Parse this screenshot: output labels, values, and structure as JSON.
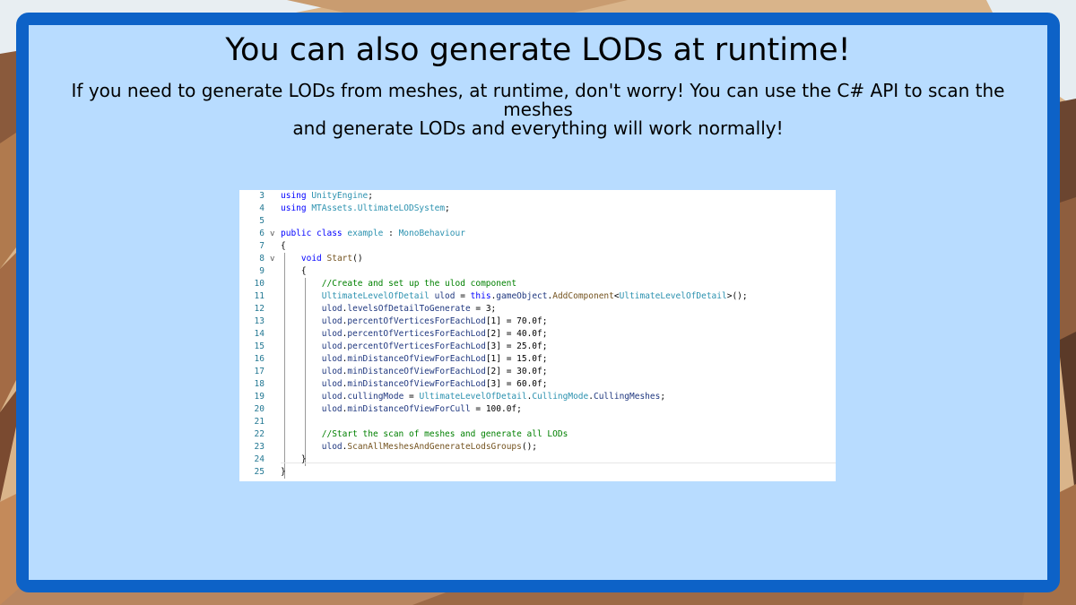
{
  "slide": {
    "title": "You can also generate LODs at runtime!",
    "subtitle_line1": "If you need to generate LODs from meshes, at runtime, don't worry! You can use the C# API to scan the meshes",
    "subtitle_line2": "and generate LODs and everything will work normally!"
  },
  "colors": {
    "frame_border": "#0d62c7",
    "panel_background": "#b8dcff",
    "code_background": "#ffffff"
  },
  "code_lines": [
    {
      "n": "3",
      "fold": "",
      "t": [
        [
          "kw",
          "using "
        ],
        [
          "ty",
          "UnityEngine"
        ],
        [
          "pl",
          ";"
        ]
      ]
    },
    {
      "n": "4",
      "fold": "",
      "t": [
        [
          "kw",
          "using "
        ],
        [
          "ty",
          "MTAssets.UltimateLODSystem"
        ],
        [
          "pl",
          ";"
        ]
      ]
    },
    {
      "n": "5",
      "fold": "",
      "t": []
    },
    {
      "n": "6",
      "fold": "v",
      "t": [
        [
          "kw",
          "public class "
        ],
        [
          "ty",
          "example"
        ],
        [
          "pl",
          " : "
        ],
        [
          "ty",
          "MonoBehaviour"
        ]
      ]
    },
    {
      "n": "7",
      "fold": "",
      "t": [
        [
          "pl",
          "{"
        ]
      ]
    },
    {
      "n": "8",
      "fold": "v",
      "t": [
        [
          "pl",
          "    "
        ],
        [
          "kw",
          "void "
        ],
        [
          "mt",
          "Start"
        ],
        [
          "pl",
          "()"
        ]
      ]
    },
    {
      "n": "9",
      "fold": "",
      "t": [
        [
          "pl",
          "    {"
        ]
      ]
    },
    {
      "n": "10",
      "fold": "",
      "t": [
        [
          "pl",
          "        "
        ],
        [
          "cm",
          "//Create and set up the ulod component"
        ]
      ]
    },
    {
      "n": "11",
      "fold": "",
      "t": [
        [
          "pl",
          "        "
        ],
        [
          "ty",
          "UltimateLevelOfDetail"
        ],
        [
          "pl",
          " "
        ],
        [
          "id",
          "ulod"
        ],
        [
          "pl",
          " = "
        ],
        [
          "kw",
          "this"
        ],
        [
          "pl",
          "."
        ],
        [
          "id",
          "gameObject"
        ],
        [
          "pl",
          "."
        ],
        [
          "mt",
          "AddComponent"
        ],
        [
          "pl",
          "<"
        ],
        [
          "ty",
          "UltimateLevelOfDetail"
        ],
        [
          "pl",
          ">();"
        ]
      ]
    },
    {
      "n": "12",
      "fold": "",
      "t": [
        [
          "pl",
          "        "
        ],
        [
          "id",
          "ulod"
        ],
        [
          "pl",
          "."
        ],
        [
          "id",
          "levelsOfDetailToGenerate"
        ],
        [
          "pl",
          " = 3;"
        ]
      ]
    },
    {
      "n": "13",
      "fold": "",
      "t": [
        [
          "pl",
          "        "
        ],
        [
          "id",
          "ulod"
        ],
        [
          "pl",
          "."
        ],
        [
          "id",
          "percentOfVerticesForEachLod"
        ],
        [
          "pl",
          "[1] = 70.0f;"
        ]
      ]
    },
    {
      "n": "14",
      "fold": "",
      "t": [
        [
          "pl",
          "        "
        ],
        [
          "id",
          "ulod"
        ],
        [
          "pl",
          "."
        ],
        [
          "id",
          "percentOfVerticesForEachLod"
        ],
        [
          "pl",
          "[2] = 40.0f;"
        ]
      ]
    },
    {
      "n": "15",
      "fold": "",
      "t": [
        [
          "pl",
          "        "
        ],
        [
          "id",
          "ulod"
        ],
        [
          "pl",
          "."
        ],
        [
          "id",
          "percentOfVerticesForEachLod"
        ],
        [
          "pl",
          "[3] = 25.0f;"
        ]
      ]
    },
    {
      "n": "16",
      "fold": "",
      "t": [
        [
          "pl",
          "        "
        ],
        [
          "id",
          "ulod"
        ],
        [
          "pl",
          "."
        ],
        [
          "id",
          "minDistanceOfViewForEachLod"
        ],
        [
          "pl",
          "[1] = 15.0f;"
        ]
      ]
    },
    {
      "n": "17",
      "fold": "",
      "t": [
        [
          "pl",
          "        "
        ],
        [
          "id",
          "ulod"
        ],
        [
          "pl",
          "."
        ],
        [
          "id",
          "minDistanceOfViewForEachLod"
        ],
        [
          "pl",
          "[2] = 30.0f;"
        ]
      ]
    },
    {
      "n": "18",
      "fold": "",
      "t": [
        [
          "pl",
          "        "
        ],
        [
          "id",
          "ulod"
        ],
        [
          "pl",
          "."
        ],
        [
          "id",
          "minDistanceOfViewForEachLod"
        ],
        [
          "pl",
          "[3] = 60.0f;"
        ]
      ]
    },
    {
      "n": "19",
      "fold": "",
      "t": [
        [
          "pl",
          "        "
        ],
        [
          "id",
          "ulod"
        ],
        [
          "pl",
          "."
        ],
        [
          "id",
          "cullingMode"
        ],
        [
          "pl",
          " = "
        ],
        [
          "ty",
          "UltimateLevelOfDetail"
        ],
        [
          "pl",
          "."
        ],
        [
          "ty",
          "CullingMode"
        ],
        [
          "pl",
          "."
        ],
        [
          "id",
          "CullingMeshes"
        ],
        [
          "pl",
          ";"
        ]
      ]
    },
    {
      "n": "20",
      "fold": "",
      "t": [
        [
          "pl",
          "        "
        ],
        [
          "id",
          "ulod"
        ],
        [
          "pl",
          "."
        ],
        [
          "id",
          "minDistanceOfViewForCull"
        ],
        [
          "pl",
          " = 100.0f;"
        ]
      ]
    },
    {
      "n": "21",
      "fold": "",
      "t": []
    },
    {
      "n": "22",
      "fold": "",
      "t": [
        [
          "pl",
          "        "
        ],
        [
          "cm",
          "//Start the scan of meshes and generate all LODs"
        ]
      ]
    },
    {
      "n": "23",
      "fold": "",
      "t": [
        [
          "pl",
          "        "
        ],
        [
          "id",
          "ulod"
        ],
        [
          "pl",
          "."
        ],
        [
          "mt",
          "ScanAllMeshesAndGenerateLodsGroups"
        ],
        [
          "pl",
          "();"
        ]
      ]
    },
    {
      "n": "24",
      "fold": "",
      "t": [
        [
          "pl",
          "    }"
        ]
      ]
    },
    {
      "n": "25",
      "fold": "",
      "t": [
        [
          "pl",
          "}"
        ]
      ]
    }
  ]
}
